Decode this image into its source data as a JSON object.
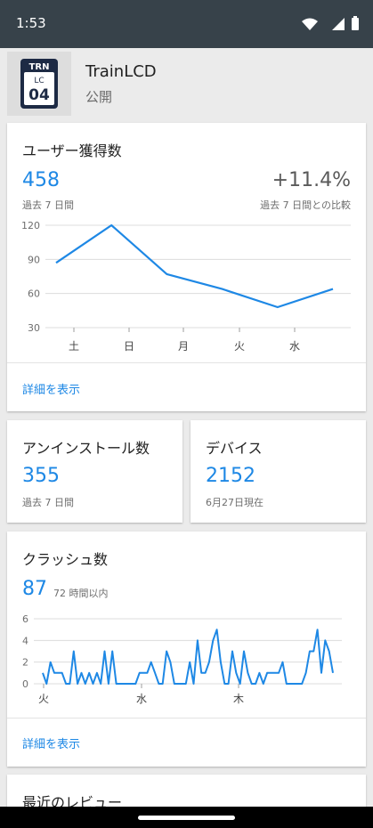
{
  "status_bar": {
    "time": "1:53"
  },
  "app": {
    "icon_top": "TRN",
    "icon_line": "LC",
    "icon_number": "04",
    "name": "TrainLCD",
    "status": "公開"
  },
  "user_acquisition": {
    "title": "ユーザー獲得数",
    "count": "458",
    "period": "過去 7 日間",
    "change": "+11.4%",
    "change_label": "過去 7 日間との比較",
    "link": "詳細を表示"
  },
  "uninstalls": {
    "title": "アンインストール数",
    "count": "355",
    "period": "過去 7 日間"
  },
  "devices": {
    "title": "デバイス",
    "count": "2152",
    "as_of": "6月27日現在"
  },
  "crashes": {
    "title": "クラッシュ数",
    "count": "87",
    "period": "72 時間以内",
    "link": "詳細を表示"
  },
  "reviews": {
    "title": "最近のレビュー"
  },
  "chart_data": [
    {
      "type": "line",
      "categories": [
        "土",
        "日",
        "月",
        "火",
        "水"
      ],
      "x": [
        0,
        1,
        2,
        3,
        4,
        5
      ],
      "values": [
        87,
        120,
        77,
        64,
        48,
        64
      ],
      "yticks": [
        120,
        90,
        60,
        30
      ],
      "ylim": [
        30,
        120
      ],
      "grid": true,
      "color": "#1e88e5"
    },
    {
      "type": "line",
      "categories": [
        "火",
        "水",
        "木"
      ],
      "values": [
        1,
        0,
        2,
        1,
        1,
        1,
        0,
        0,
        3,
        0,
        1,
        0,
        1,
        0,
        1,
        0,
        3,
        0,
        3,
        0,
        0,
        0,
        0,
        0,
        0,
        1,
        1,
        1,
        2,
        1,
        0,
        0,
        3,
        2,
        0,
        0,
        0,
        0,
        2,
        0,
        4,
        1,
        1,
        2,
        4,
        5,
        2,
        0,
        0,
        3,
        1,
        0,
        3,
        1,
        0,
        0,
        1,
        0,
        1,
        1,
        1,
        1,
        2,
        0,
        0,
        0,
        0,
        0,
        1,
        3,
        3,
        5,
        1,
        4,
        3,
        1
      ],
      "yticks": [
        6,
        4,
        2,
        0
      ],
      "ylim": [
        0,
        6
      ],
      "grid": true,
      "color": "#1e88e5"
    }
  ]
}
